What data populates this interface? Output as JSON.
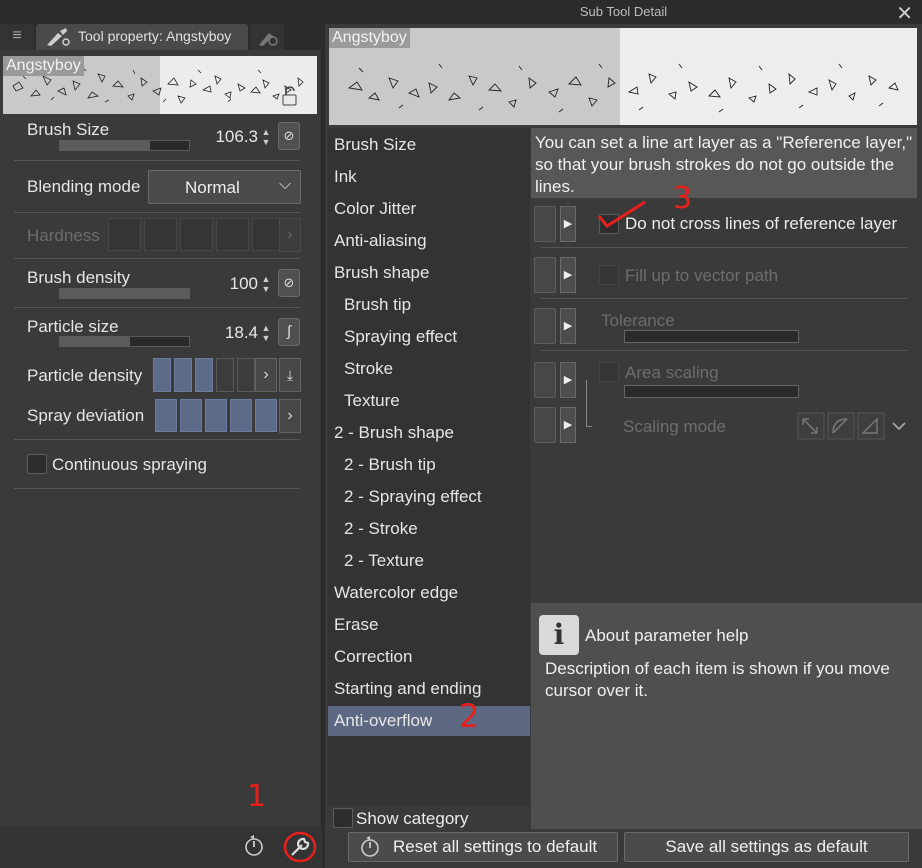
{
  "left_panel": {
    "menu_icon": "hamburger-icon",
    "tab_label": "Tool property: Angstyboy",
    "preview_name": "Angstyboy",
    "rows": {
      "brush_size": {
        "label": "Brush Size",
        "value": "106.3",
        "level": 0.62
      },
      "blending_mode": {
        "label": "Blending mode",
        "value": "Normal"
      },
      "hardness": {
        "label": "Hardness"
      },
      "brush_density": {
        "label": "Brush density",
        "value": "100",
        "level": 1.0
      },
      "particle_size": {
        "label": "Particle size",
        "value": "18.4",
        "level": 0.54
      },
      "particle_density": {
        "label": "Particle density"
      },
      "spray_deviation": {
        "label": "Spray deviation"
      },
      "continuous_spraying": {
        "label": "Continuous spraying"
      }
    },
    "annotation_1": "1"
  },
  "dialog": {
    "title": "Sub Tool Detail",
    "close": "✕",
    "preview_name": "Angstyboy",
    "categories": [
      {
        "label": "Brush Size",
        "sub": false
      },
      {
        "label": "Ink",
        "sub": false
      },
      {
        "label": "Color Jitter",
        "sub": false
      },
      {
        "label": "Anti-aliasing",
        "sub": false
      },
      {
        "label": "Brush shape",
        "sub": false
      },
      {
        "label": "Brush tip",
        "sub": true
      },
      {
        "label": "Spraying effect",
        "sub": true
      },
      {
        "label": "Stroke",
        "sub": true
      },
      {
        "label": "Texture",
        "sub": true
      },
      {
        "label": "2 - Brush shape",
        "sub": false
      },
      {
        "label": "2 - Brush tip",
        "sub": true
      },
      {
        "label": "2 - Spraying effect",
        "sub": true
      },
      {
        "label": "2 - Stroke",
        "sub": true
      },
      {
        "label": "2 - Texture",
        "sub": true
      },
      {
        "label": "Watercolor edge",
        "sub": false
      },
      {
        "label": "Erase",
        "sub": false
      },
      {
        "label": "Correction",
        "sub": false
      },
      {
        "label": "Starting and ending",
        "sub": false
      },
      {
        "label": "Anti-overflow",
        "sub": false,
        "selected": true
      }
    ],
    "help_text_top": "You can set a line art layer as a \"Reference layer,\" so that your brush strokes do not go outside the lines.",
    "params": {
      "do_not_cross": "Do not cross lines of reference layer",
      "fill_up": "Fill up to vector path",
      "tolerance": "Tolerance",
      "area_scaling": "Area scaling",
      "scaling_mode": "Scaling mode"
    },
    "about_title": "About parameter help",
    "about_text": "Description of each item is shown if you move cursor over it.",
    "show_category": "Show category",
    "reset_button": "Reset all settings to default",
    "save_button": "Save all settings as default",
    "annotation_2": "2",
    "annotation_3": "3"
  }
}
